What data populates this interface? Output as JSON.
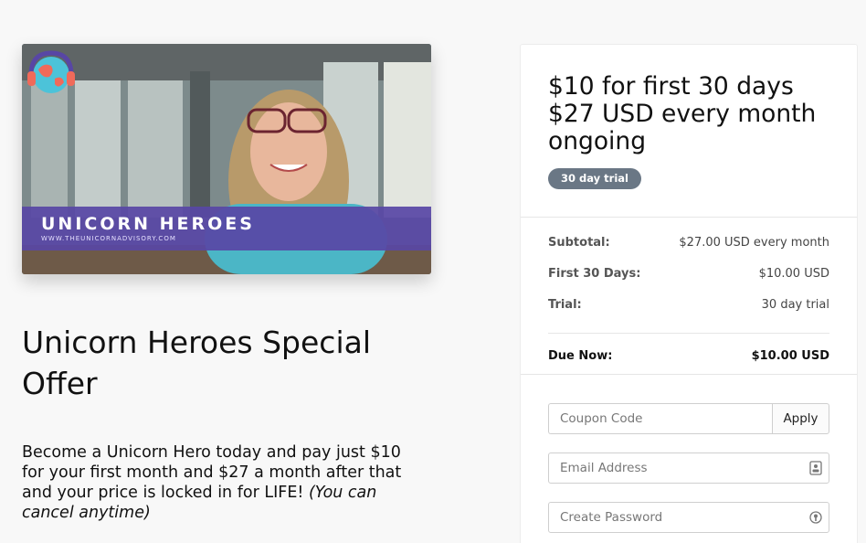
{
  "hero": {
    "title": "UNICORN HEROES",
    "subtitle": "WWW.THEUNICORNADVISORY.COM"
  },
  "product": {
    "title": "Unicorn Heroes Special Offer",
    "description_main": "Become a Unicorn Hero today and pay just $10 for your first month and $27 a month after that and your price is locked in for LIFE!",
    "description_italic": "(You can cancel anytime)"
  },
  "pricing": {
    "line1": "$10 for first 30 days",
    "line2": "$27 USD every month",
    "line3": "ongoing",
    "badge": "30 day trial"
  },
  "summary": {
    "rows": [
      {
        "label": "Subtotal:",
        "value": "$27.00 USD every month"
      },
      {
        "label": "First 30 Days:",
        "value": "$10.00 USD"
      },
      {
        "label": "Trial:",
        "value": "30 day trial"
      }
    ],
    "due_label": "Due Now:",
    "due_value": "$10.00 USD"
  },
  "form": {
    "coupon_placeholder": "Coupon Code",
    "apply_label": "Apply",
    "email_placeholder": "Email Address",
    "password_placeholder": "Create Password"
  },
  "colors": {
    "banner": "#5846a5",
    "badge": "#6a7785"
  }
}
